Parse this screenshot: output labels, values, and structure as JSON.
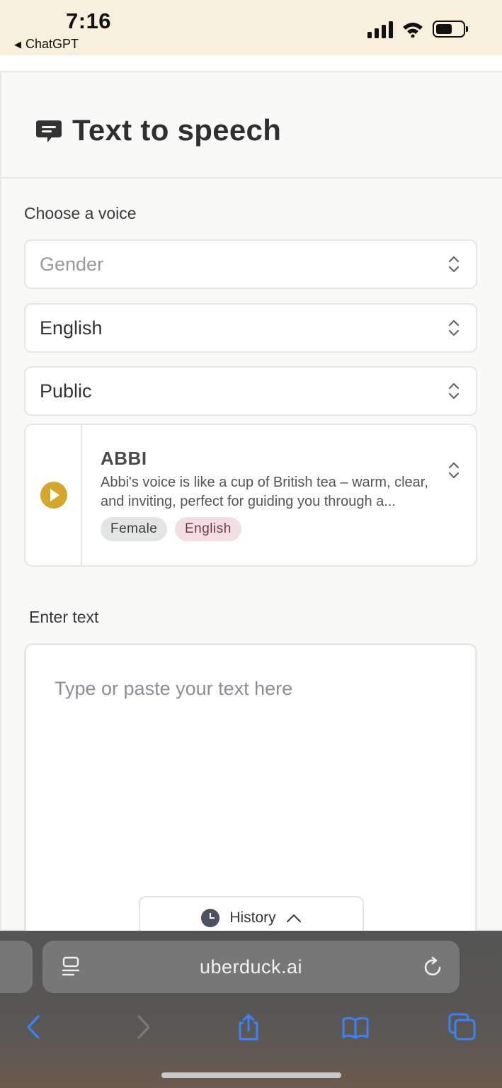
{
  "status_bar": {
    "time": "7:16",
    "back_app": "ChatGPT",
    "icons": [
      "cellular-signal-icon",
      "wifi-icon",
      "battery-icon"
    ]
  },
  "header": {
    "title": "Text to speech",
    "icon": "speech-bubble-icon"
  },
  "voice_section": {
    "label": "Choose a voice",
    "gender_select": {
      "placeholder": "Gender"
    },
    "language_select": {
      "value": "English"
    },
    "visibility_select": {
      "value": "Public"
    }
  },
  "voice_card": {
    "name": "ABBI",
    "description": "Abbi's voice is like a cup of British tea – warm, clear, and inviting, perfect for guiding you through a...",
    "tags": [
      "Female",
      "English"
    ],
    "accent_color": "#d4a72c"
  },
  "text_section": {
    "label": "Enter text",
    "placeholder": "Type or paste your text here"
  },
  "history": {
    "label": "History"
  },
  "browser": {
    "url": "uberduck.ai",
    "toolbar": [
      "back-icon",
      "forward-icon",
      "share-icon",
      "bookmarks-icon",
      "tabs-icon"
    ]
  }
}
